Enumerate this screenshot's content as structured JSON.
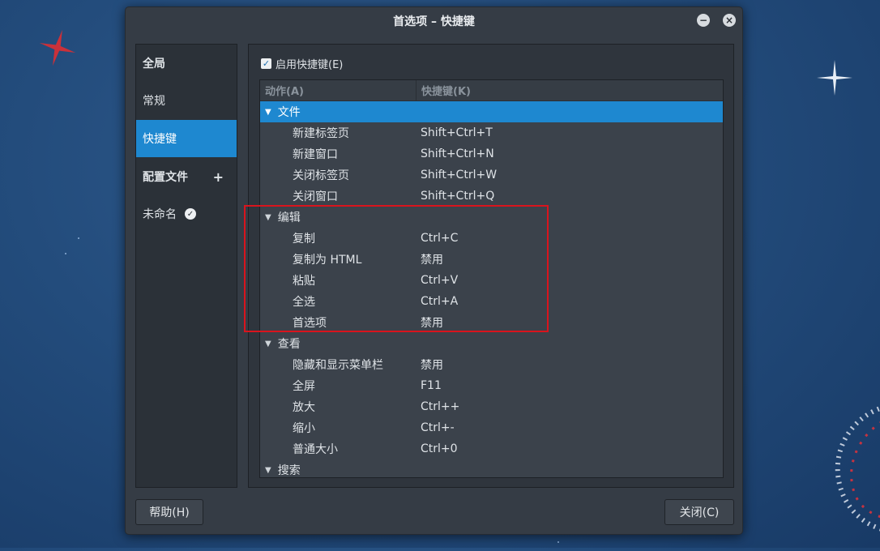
{
  "window": {
    "title": "首选项 – 快捷键"
  },
  "sidebar": {
    "global_heading": "全局",
    "items": [
      {
        "label": "常规"
      },
      {
        "label": "快捷键"
      }
    ],
    "profiles_heading": "配置文件",
    "profiles": [
      {
        "label": "未命名"
      }
    ]
  },
  "main": {
    "enable_label": "启用快捷键(E)",
    "enable_checked": true,
    "columns": {
      "action": "动作(A)",
      "shortcut": "快捷键(K)"
    },
    "categories": [
      {
        "label": "文件",
        "items": [
          {
            "action": "新建标签页",
            "shortcut": "Shift+Ctrl+T"
          },
          {
            "action": "新建窗口",
            "shortcut": "Shift+Ctrl+N"
          },
          {
            "action": "关闭标签页",
            "shortcut": "Shift+Ctrl+W"
          },
          {
            "action": "关闭窗口",
            "shortcut": "Shift+Ctrl+Q"
          }
        ]
      },
      {
        "label": "编辑",
        "items": [
          {
            "action": "复制",
            "shortcut": "Ctrl+C"
          },
          {
            "action": "复制为 HTML",
            "shortcut": "禁用"
          },
          {
            "action": "粘贴",
            "shortcut": "Ctrl+V"
          },
          {
            "action": "全选",
            "shortcut": "Ctrl+A"
          },
          {
            "action": "首选项",
            "shortcut": "禁用"
          }
        ]
      },
      {
        "label": "查看",
        "items": [
          {
            "action": "隐藏和显示菜单栏",
            "shortcut": "禁用"
          },
          {
            "action": "全屏",
            "shortcut": "F11"
          },
          {
            "action": "放大",
            "shortcut": "Ctrl++"
          },
          {
            "action": "缩小",
            "shortcut": "Ctrl+-"
          },
          {
            "action": "普通大小",
            "shortcut": "Ctrl+0"
          }
        ]
      },
      {
        "label": "搜索",
        "items": []
      }
    ]
  },
  "footer": {
    "help_label": "帮助(H)",
    "close_label": "关闭(C)"
  },
  "colors": {
    "accent": "#1e88d0",
    "highlight_box": "#d9141d"
  }
}
